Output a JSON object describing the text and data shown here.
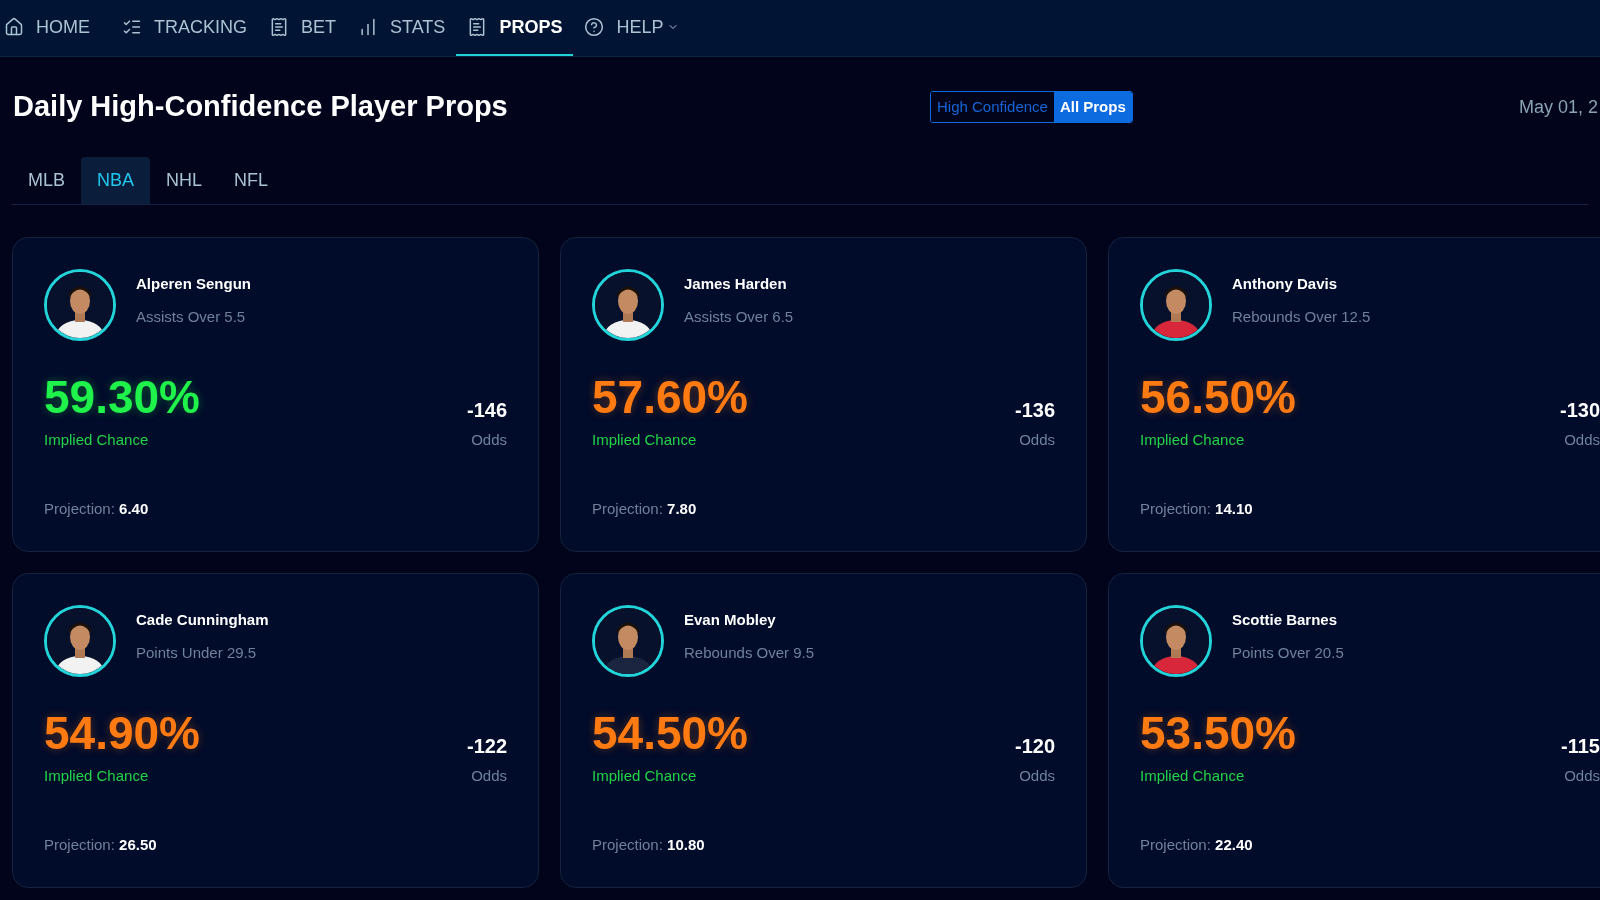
{
  "nav": [
    {
      "kind": "home",
      "label": "HOME",
      "selected": false
    },
    {
      "kind": "tracking",
      "label": "TRACKING",
      "selected": false
    },
    {
      "kind": "bet",
      "label": "BET",
      "selected": false
    },
    {
      "kind": "stats",
      "label": "STATS",
      "selected": false
    },
    {
      "kind": "props",
      "label": "PROPS",
      "selected": true
    },
    {
      "kind": "help",
      "label": "HELP",
      "selected": false,
      "dropdown": true
    }
  ],
  "title": "Daily High-Confidence Player Props",
  "filter": [
    {
      "label": "High Confidence",
      "selected": false
    },
    {
      "label": "All Props",
      "selected": true
    }
  ],
  "date": "May 01, 2",
  "sports": [
    {
      "label": "MLB",
      "selected": false
    },
    {
      "label": "NBA",
      "selected": true
    },
    {
      "label": "NHL",
      "selected": false
    },
    {
      "label": "NFL",
      "selected": false
    }
  ],
  "cards": [
    {
      "name": "Alperen Sengun",
      "prop": "Assists Over 5.5",
      "chance": "59.30%",
      "color": "#1ff24a",
      "chance_label": "Implied Chance",
      "odds": "-146",
      "odds_label": "Odds",
      "projection_label": "Projection:",
      "projection": "6.40"
    },
    {
      "name": "James Harden",
      "prop": "Assists Over 6.5",
      "chance": "57.60%",
      "color": "#ff7b12",
      "chance_label": "Implied Chance",
      "odds": "-136",
      "odds_label": "Odds",
      "projection_label": "Projection:",
      "projection": "7.80"
    },
    {
      "name": "Anthony Davis",
      "prop": "Rebounds Over 12.5",
      "chance": "56.50%",
      "color": "#ff7b12",
      "chance_label": "Implied Chance",
      "odds": "-130",
      "odds_label": "Odds",
      "projection_label": "Projection:",
      "projection": "14.10"
    },
    {
      "name": "Cade Cunningham",
      "prop": "Points Under 29.5",
      "chance": "54.90%",
      "color": "#ff7b12",
      "chance_label": "Implied Chance",
      "odds": "-122",
      "odds_label": "Odds",
      "projection_label": "Projection:",
      "projection": "26.50"
    },
    {
      "name": "Evan Mobley",
      "prop": "Rebounds Over 9.5",
      "chance": "54.50%",
      "color": "#ff7b12",
      "chance_label": "Implied Chance",
      "odds": "-120",
      "odds_label": "Odds",
      "projection_label": "Projection:",
      "projection": "10.80"
    },
    {
      "name": "Scottie Barnes",
      "prop": "Points Over 20.5",
      "chance": "53.50%",
      "color": "#ff7b12",
      "chance_label": "Implied Chance",
      "odds": "-115",
      "odds_label": "Odds",
      "projection_label": "Projection:",
      "projection": "22.40"
    }
  ]
}
